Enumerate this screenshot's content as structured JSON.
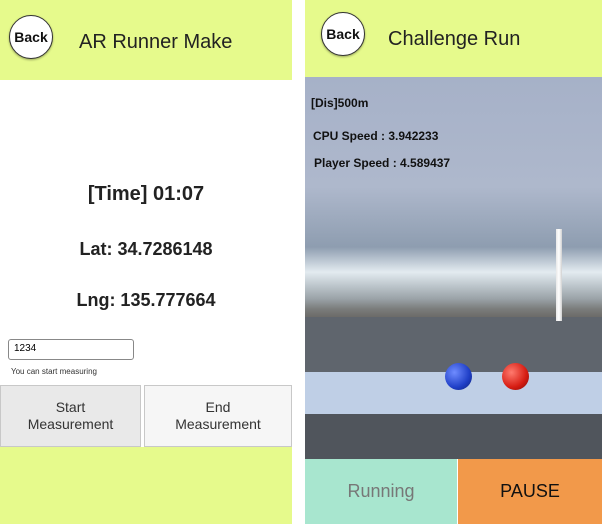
{
  "left": {
    "header": {
      "back_label": "Back",
      "title": "AR Runner Make"
    },
    "time_text": "[Time] 01:07",
    "lat_text": "Lat: 34.7286148",
    "lng_text": "Lng: 135.777664",
    "input": {
      "value": "1234"
    },
    "hint_text": "You can start measuring",
    "start_button": {
      "line1": "Start",
      "line2": "Measurement"
    },
    "end_button": {
      "line1": "End",
      "line2": "Measurement"
    }
  },
  "right": {
    "header": {
      "back_label": "Back",
      "title": "Challenge Run"
    },
    "hud": {
      "distance": "[Dis]500m",
      "cpu_speed": "CPU Speed : 3.942233",
      "player_speed": "Player Speed : 4.589437"
    },
    "running_label": "Running",
    "pause_label": "PAUSE",
    "colors": {
      "header_bg": "#e6fa8c",
      "running_bg": "#a8e6cf",
      "pause_bg": "#f2994a",
      "cpu_ball": "blue",
      "player_ball": "red"
    }
  }
}
